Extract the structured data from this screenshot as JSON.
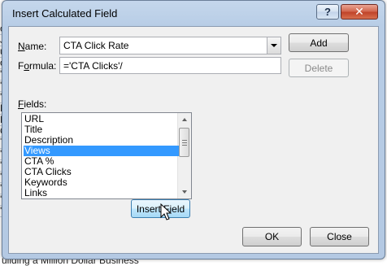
{
  "background": {
    "row_snippets": [
      "o",
      "J",
      "u",
      "o",
      "'c",
      "'t",
      "'l",
      "P",
      "B",
      "G",
      "T",
      "'c",
      "'c",
      "'c",
      "'c",
      "'c",
      "'c"
    ],
    "bottom_text": "uilding a Million Dollar Business"
  },
  "dialog": {
    "title": "Insert Calculated Field",
    "help_label": "?",
    "close_label": "✕",
    "name_label": "Name:",
    "name_accel": "N",
    "name_rest": "ame:",
    "name_value": "CTA Click Rate",
    "formula_label_accel": "o",
    "formula_label_pre": "F",
    "formula_label_post": "rmula:",
    "formula_value": "='CTA Clicks'/",
    "add_label": "Add",
    "delete_label": "Delete",
    "fields_label_accel": "F",
    "fields_label_rest": "ields:",
    "fields": [
      "URL",
      "Title",
      "Description",
      "Views",
      "CTA %",
      "CTA Clicks",
      "Keywords",
      "Links"
    ],
    "selected_field": "Views",
    "insert_field_label": "Insert Field",
    "ok_label": "OK",
    "dialog_close_label": "Close"
  },
  "colors": {
    "selection": "#3399ff",
    "title_close_button": "#c7432b",
    "frame": "#b8cde6"
  }
}
